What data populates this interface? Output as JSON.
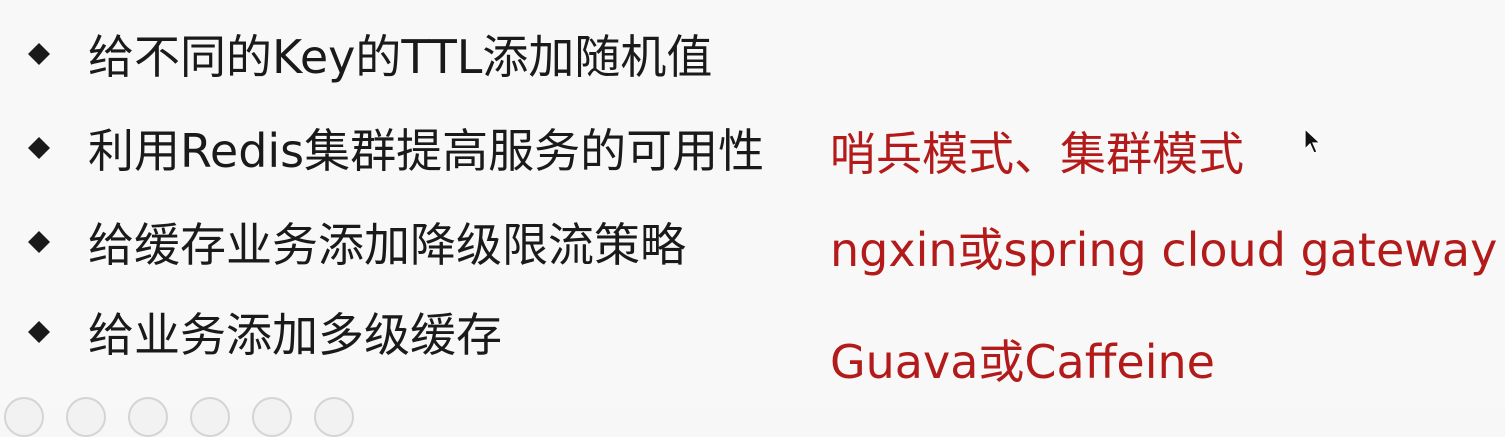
{
  "bullets": [
    {
      "text": "给不同的Key的TTL添加随机值",
      "note": ""
    },
    {
      "text": "利用Redis集群提高服务的可用性",
      "note": "哨兵模式、集群模式"
    },
    {
      "text": "给缓存业务添加降级限流策略",
      "note": "ngxin或spring cloud gateway"
    },
    {
      "text": "给业务添加多级缓存",
      "note": "Guava或Caffeine"
    }
  ],
  "colors": {
    "bullet": "#1a1a1a",
    "text": "#1a1a1a",
    "note": "#b31b1b"
  },
  "icons": {
    "bullet": "diamond-bullet-icon",
    "cursor": "mouse-pointer-icon"
  }
}
